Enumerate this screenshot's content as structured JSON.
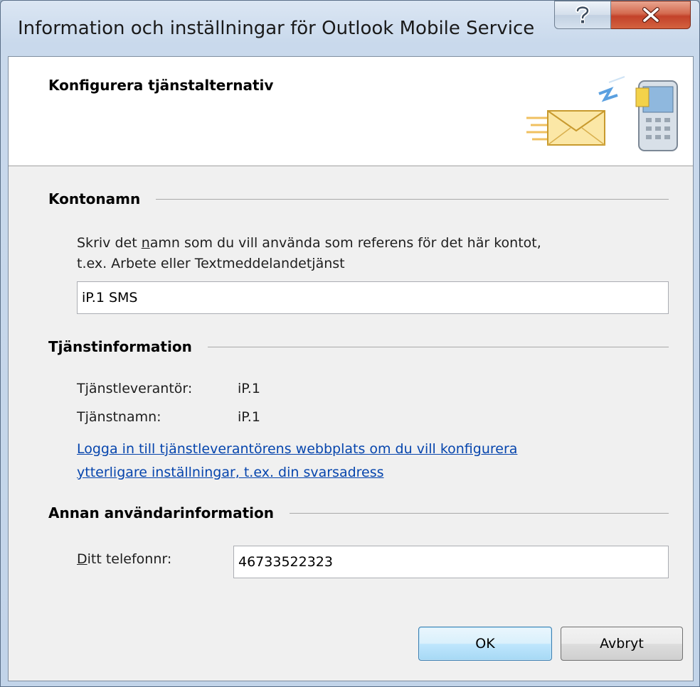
{
  "window": {
    "title": "Information och inställningar för Outlook Mobile Service"
  },
  "caption_buttons": {
    "help_icon": "help-question-icon",
    "close_icon": "close-x-icon"
  },
  "header": {
    "title": "Konfigurera tjänstalternativ",
    "icon": "mail-to-mobile-icon"
  },
  "account_section": {
    "heading": "Kontonamn",
    "description_prefix": "Skriv det ",
    "description_accel": "n",
    "description_suffix": "amn som du vill använda som referens för det här kontot,",
    "description_line2": "t.ex. Arbete eller Textmeddelandetjänst",
    "account_name_value": "iP.1 SMS"
  },
  "service_section": {
    "heading": "Tjänstinformation",
    "provider_label": "Tjänstleverantör:",
    "provider_value": "iP.1",
    "service_name_label": "Tjänstnamn:",
    "service_name_value": "iP.1",
    "link_line1": "Logga in till tjänstleverantörens webbplats om du vill konfigurera",
    "link_line2": "ytterligare inställningar, t.ex. din svarsadress"
  },
  "user_section": {
    "heading": "Annan användarinformation",
    "phone_label_accel": "D",
    "phone_label_rest": "itt telefonnr:",
    "phone_value": "46733522323"
  },
  "buttons": {
    "ok_label": "OK",
    "cancel_label": "Avbryt"
  },
  "colors": {
    "link": "#0645ad",
    "close_button": "#c3422a",
    "default_button_border": "#3c7fb1"
  }
}
